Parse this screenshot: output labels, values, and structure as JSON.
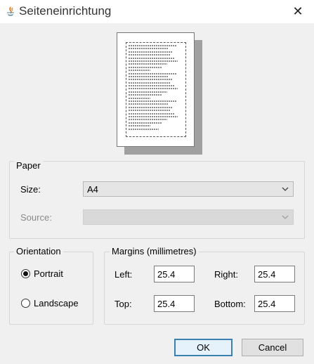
{
  "window": {
    "title": "Seiteneinrichtung",
    "close_glyph": "✕"
  },
  "paper": {
    "legend": "Paper",
    "size_label": "Size:",
    "size_value": "A4",
    "source_label": "Source:",
    "source_value": ""
  },
  "orientation": {
    "legend": "Orientation",
    "portrait_label": "Portrait",
    "landscape_label": "Landscape",
    "selected": "portrait"
  },
  "margins": {
    "legend": "Margins (millimetres)",
    "left_label": "Left:",
    "left_value": "25.4",
    "right_label": "Right:",
    "right_value": "25.4",
    "top_label": "Top:",
    "top_value": "25.4",
    "bottom_label": "Bottom:",
    "bottom_value": "25.4"
  },
  "buttons": {
    "ok": "OK",
    "cancel": "Cancel"
  },
  "colors": {
    "accent": "#3c7fb1",
    "window_bg": "#f0f0f0"
  }
}
